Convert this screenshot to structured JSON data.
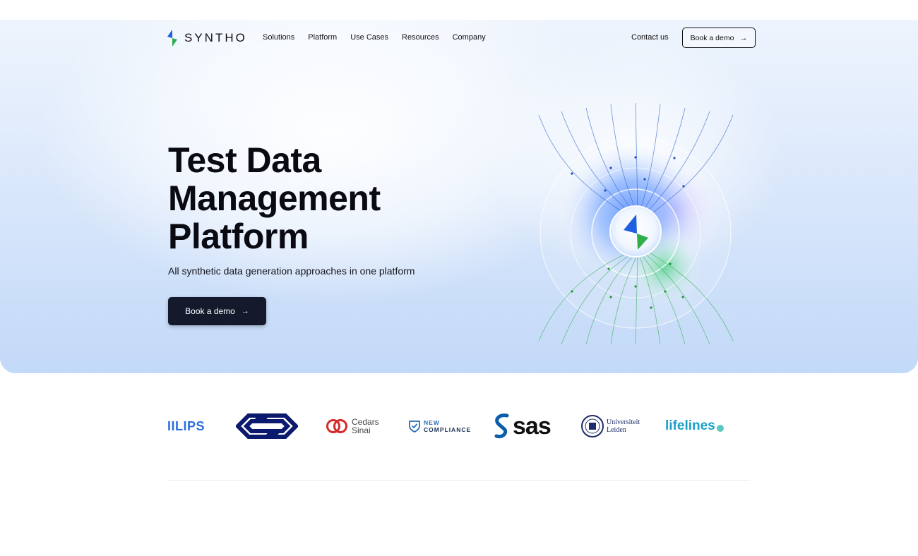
{
  "nav": {
    "brand": "SYNTHO",
    "menu": [
      "Solutions",
      "Platform",
      "Use Cases",
      "Resources",
      "Company"
    ],
    "contact_label": "Contact us",
    "demo_label": "Book a demo"
  },
  "hero": {
    "title_lines": [
      "Test Data",
      "Management",
      "Platform"
    ],
    "subtitle": "All synthetic data generation approaches in one platform",
    "cta_label": "Book a demo"
  },
  "logos": {
    "philips": "IILIPS",
    "cedars_line1": "Cedars",
    "cedars_line2": "Sinai",
    "newc_line1": "NEW",
    "newc_line2": "COMPLIANCE",
    "sas": "sas",
    "leiden_line1": "Universiteit",
    "leiden_line2": "Leiden",
    "lifelines": "lifelines"
  },
  "colors": {
    "accent_blue": "#1f5fe0",
    "accent_green": "#2fae4a",
    "cta_bg": "#141a2c",
    "philips_blue": "#2a6fdb",
    "ns_navy": "#0b1a6e",
    "cedars_red": "#d62a2a",
    "newc_blue": "#2b6cb0",
    "sas_blue": "#0a5cac",
    "leiden_navy": "#1d2d6b",
    "lifelines_teal": "#1aa0c8"
  }
}
